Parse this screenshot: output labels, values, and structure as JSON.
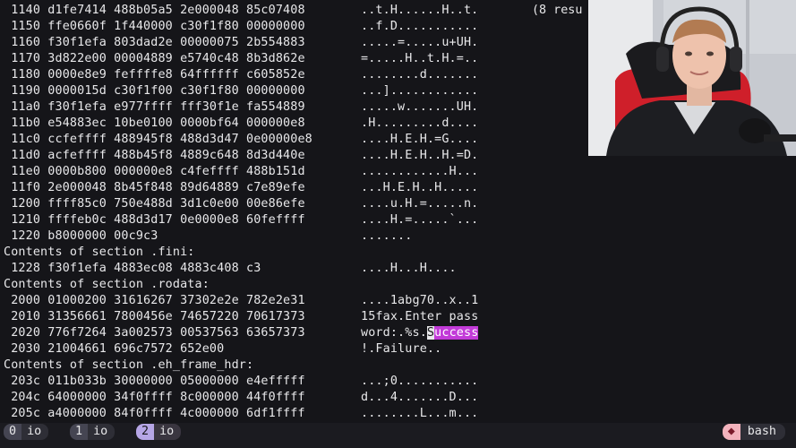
{
  "terminal": {
    "lines": [
      {
        "hex": " 1140 d1fe7414 488b05a5 2e000048 85c07408",
        "ascii": "..t.H......H..t."
      },
      {
        "hex": " 1150 ffe0660f 1f440000 c30f1f80 00000000",
        "ascii": "..f.D..........."
      },
      {
        "hex": " 1160 f30f1efa 803dad2e 00000075 2b554883",
        "ascii": ".....=.....u+UH."
      },
      {
        "hex": " 1170 3d822e00 00004889 e5740c48 8b3d862e",
        "ascii": "=.....H..t.H.=.."
      },
      {
        "hex": " 1180 0000e8e9 feffffe8 64ffffff c605852e",
        "ascii": "........d......."
      },
      {
        "hex": " 1190 0000015d c30f1f00 c30f1f80 00000000",
        "ascii": "...]............"
      },
      {
        "hex": " 11a0 f30f1efa e977ffff fff30f1e fa554889",
        "ascii": ".....w.......UH."
      },
      {
        "hex": " 11b0 e54883ec 10be0100 0000bf64 000000e8",
        "ascii": ".H.........d...."
      },
      {
        "hex": " 11c0 ccfeffff 488945f8 488d3d47 0e00000e8",
        "ascii": "....H.E.H.=G...."
      },
      {
        "hex": " 11d0 acfeffff 488b45f8 4889c648 8d3d440e",
        "ascii": "....H.E.H..H.=D."
      },
      {
        "hex": " 11e0 0000b800 000000e8 c4feffff 488b151d",
        "ascii": "............H..."
      },
      {
        "hex": " 11f0 2e000048 8b45f848 89d64889 c7e89efe",
        "ascii": "...H.E.H..H....."
      },
      {
        "hex": " 1200 ffff85c0 750e488d 3d1c0e00 00e86efe",
        "ascii": "....u.H.=.....n."
      },
      {
        "hex": " 1210 ffffeb0c 488d3d17 0e0000e8 60feffff",
        "ascii": "....H.=.....`..."
      },
      {
        "hex": " 1220 b8000000 00c9c3",
        "ascii": "......."
      },
      {
        "hex": "Contents of section .fini:",
        "ascii": ""
      },
      {
        "hex": " 1228 f30f1efa 4883ec08 4883c408 c3",
        "ascii": "....H...H...."
      },
      {
        "hex": "Contents of section .rodata:",
        "ascii": ""
      },
      {
        "hex": " 2000 01000200 31616267 37302e2e 782e2e31",
        "ascii": "....1abg70..x..1"
      },
      {
        "hex": " 2010 31356661 7800456e 74657220 70617373",
        "ascii": "15fax.Enter pass"
      },
      {
        "hex": " 2020 776f7264 3a002573 00537563 63657373",
        "ascii": "word:.%s.Success"
      },
      {
        "hex": " 2030 21004661 696c7572 652e00",
        "ascii": "!.Failure.."
      },
      {
        "hex": "Contents of section .eh_frame_hdr:",
        "ascii": ""
      },
      {
        "hex": " 203c 011b033b 30000000 05000000 e4efffff",
        "ascii": "...;0..........."
      },
      {
        "hex": " 204c 64000000 34f0ffff 8c000000 44f0ffff",
        "ascii": "d...4.......D..."
      },
      {
        "hex": " 205c a4000000 84f0ffff 4c000000 6df1ffff",
        "ascii": "........L...m..."
      }
    ],
    "highlight": {
      "line": 20,
      "prefix": "word:.%s.",
      "cursor": "S",
      "rest": "uccess"
    },
    "topright_text": "(8 resu"
  },
  "webcam": {
    "label": "webcam-feed"
  },
  "statusbar": {
    "windows": [
      {
        "num": "0",
        "name": "io",
        "active": false
      },
      {
        "num": "1",
        "name": "io",
        "active": false
      },
      {
        "num": "2",
        "name": "io",
        "active": true
      }
    ],
    "session_icon": "◆",
    "session_name": "bash"
  }
}
